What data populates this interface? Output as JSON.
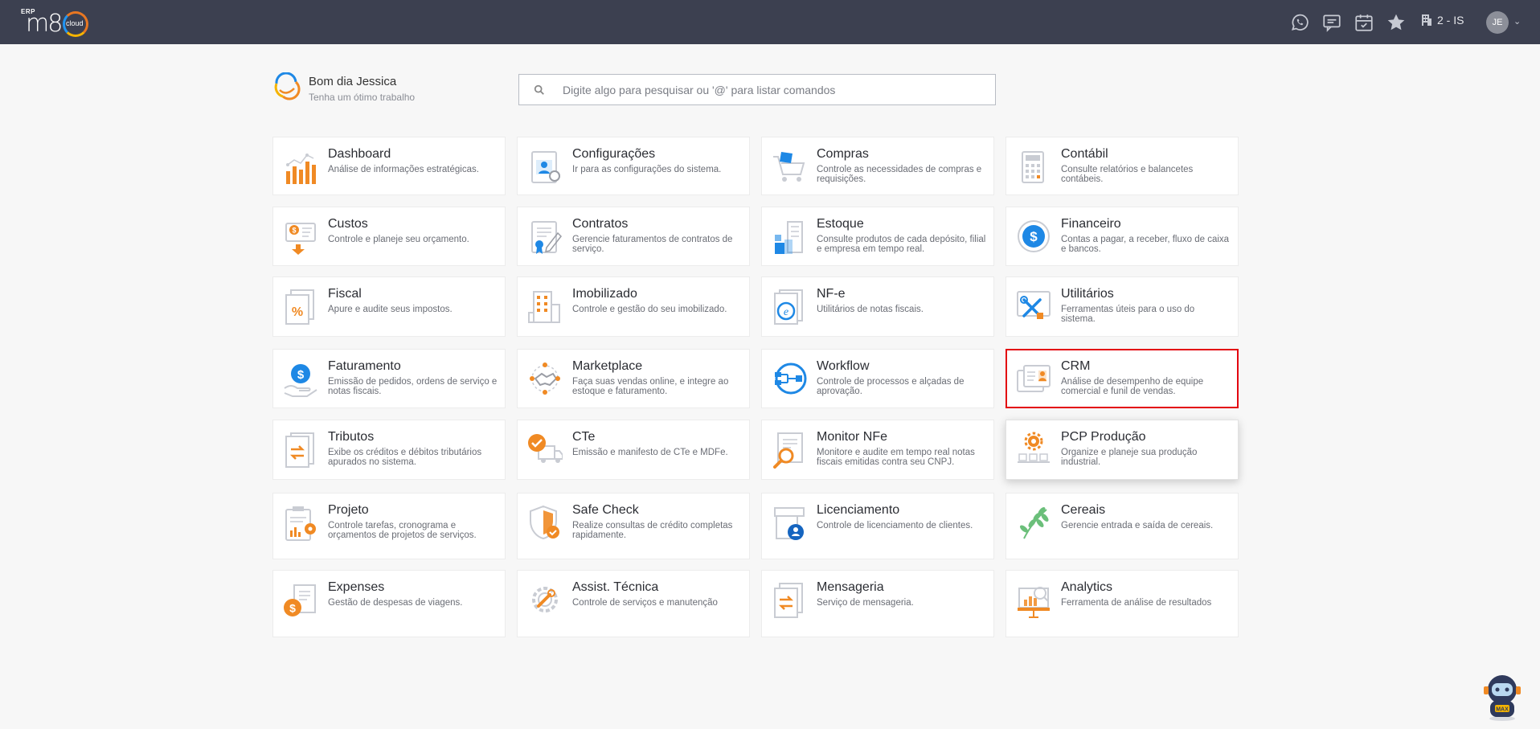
{
  "header": {
    "logo_erp": "ERP",
    "logo_main": "m8",
    "logo_cloud": "cloud",
    "company": "2 - IS",
    "avatar": "JE",
    "icons": [
      "whatsapp-icon",
      "chat-icon",
      "calendar-icon",
      "star-icon",
      "building-icon",
      "chevron-down-icon"
    ]
  },
  "greeting": {
    "title": "Bom dia Jessica",
    "subtitle": "Tenha um ótimo trabalho"
  },
  "search": {
    "placeholder": "Digite algo para pesquisar ou '@' para listar comandos"
  },
  "modules": [
    {
      "title": "Dashboard",
      "desc": "Análise de informações estratégicas.",
      "icon": "dashboard-icon"
    },
    {
      "title": "Configurações",
      "desc": "Ir para as configurações do sistema.",
      "icon": "settings-icon"
    },
    {
      "title": "Compras",
      "desc": "Controle as necessidades de compras e requisições.",
      "icon": "shopping-cart-icon"
    },
    {
      "title": "Contábil",
      "desc": "Consulte relatórios e balancetes contábeis.",
      "icon": "calculator-icon"
    },
    {
      "title": "Custos",
      "desc": "Controle e planeje seu orçamento.",
      "icon": "costs-icon"
    },
    {
      "title": "Contratos",
      "desc": "Gerencie faturamentos de contratos de serviço.",
      "icon": "contract-icon"
    },
    {
      "title": "Estoque",
      "desc": "Consulte produtos de cada depósito, filial e empresa em tempo real.",
      "icon": "warehouse-icon"
    },
    {
      "title": "Financeiro",
      "desc": "Contas a pagar, a receber, fluxo de caixa e bancos.",
      "icon": "dollar-coin-icon"
    },
    {
      "title": "Fiscal",
      "desc": "Apure e audite seus impostos.",
      "icon": "percent-document-icon"
    },
    {
      "title": "Imobilizado",
      "desc": "Controle e gestão do seu imobilizado.",
      "icon": "building-icon"
    },
    {
      "title": "NF-e",
      "desc": "Utilitários de notas fiscais.",
      "icon": "nfe-document-icon"
    },
    {
      "title": "Utilitários",
      "desc": "Ferramentas úteis para o uso do sistema.",
      "icon": "tools-icon"
    },
    {
      "title": "Faturamento",
      "desc": "Emissão de pedidos, ordens de serviço e notas fiscais.",
      "icon": "billing-icon"
    },
    {
      "title": "Marketplace",
      "desc": "Faça suas vendas online, e integre ao estoque e faturamento.",
      "icon": "handshake-icon"
    },
    {
      "title": "Workflow",
      "desc": "Controle de processos e alçadas de aprovação.",
      "icon": "workflow-icon"
    },
    {
      "title": "CRM",
      "desc": "Análise de desempenho de equipe comercial e funil de vendas.",
      "icon": "crm-icon"
    },
    {
      "title": "Tributos",
      "desc": "Exibe os créditos e débitos tributários apurados no sistema.",
      "icon": "tax-transfer-icon"
    },
    {
      "title": "CTe",
      "desc": "Emissão e manifesto de CTe e MDFe.",
      "icon": "truck-check-icon"
    },
    {
      "title": "Monitor NFe",
      "desc": "Monitore e audite em tempo real notas fiscais emitidas contra seu CNPJ.",
      "icon": "magnifier-document-icon"
    },
    {
      "title": "PCP Produção",
      "desc": "Organize e planeje sua produção industrial.",
      "icon": "production-gear-icon"
    },
    {
      "title": "Projeto",
      "desc": "Controle tarefas, cronograma e orçamentos de projetos de serviços.",
      "icon": "project-clipboard-icon"
    },
    {
      "title": "Safe Check",
      "desc": "Realize consultas de crédito completas rapidamente.",
      "icon": "shield-check-icon"
    },
    {
      "title": "Licenciamento",
      "desc": "Controle de licenciamento de clientes.",
      "icon": "license-icon"
    },
    {
      "title": "Cereais",
      "desc": "Gerencie entrada e saída de cereais.",
      "icon": "wheat-icon"
    },
    {
      "title": "Expenses",
      "desc": "Gestão de despesas de viagens.",
      "icon": "expenses-icon"
    },
    {
      "title": "Assist. Técnica",
      "desc": "Controle de serviços e manutenção",
      "icon": "wrench-gear-icon"
    },
    {
      "title": "Mensageria",
      "desc": "Serviço de mensageria.",
      "icon": "message-transfer-icon"
    },
    {
      "title": "Analytics",
      "desc": "Ferramenta de análise de resultados",
      "icon": "analytics-board-icon"
    }
  ],
  "assistant": {
    "label": "MAX"
  },
  "colors": {
    "topbar": "#3c4050",
    "accent_orange": "#f08a24",
    "accent_blue": "#1e88e5",
    "selection_red": "#e3060f"
  }
}
